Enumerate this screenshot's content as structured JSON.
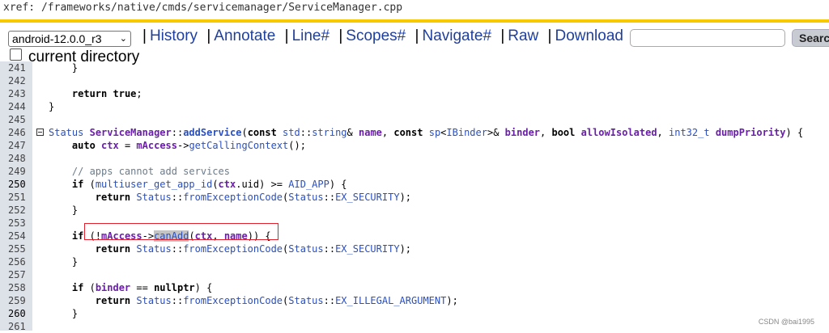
{
  "xref": {
    "path": "xref: /frameworks/native/cmds/servicemanager/ServiceManager.cpp"
  },
  "navbar": {
    "version": "android-12.0.0_r3",
    "links": [
      "History",
      "Annotate",
      "Line#",
      "Scopes#",
      "Navigate#",
      "Raw",
      "Download"
    ],
    "search_button": "Search",
    "search_value": ""
  },
  "current_directory": "current directory",
  "code": {
    "lines": [
      {
        "n": "241",
        "t": "    }"
      },
      {
        "n": "242",
        "t": ""
      },
      {
        "n": "243",
        "t": "    return true;"
      },
      {
        "n": "244",
        "t": "}"
      },
      {
        "n": "245",
        "t": ""
      },
      {
        "n": "246",
        "t": "Status ServiceManager::addService(const std::string& name, const sp<IBinder>& binder, bool allowIsolated, int32_t dumpPriority) {"
      },
      {
        "n": "247",
        "t": "    auto ctx = mAccess->getCallingContext();"
      },
      {
        "n": "248",
        "t": ""
      },
      {
        "n": "249",
        "t": "    // apps cannot add services"
      },
      {
        "n": "250",
        "t": "    if (multiuser_get_app_id(ctx.uid) >= AID_APP) {"
      },
      {
        "n": "251",
        "t": "        return Status::fromExceptionCode(Status::EX_SECURITY);"
      },
      {
        "n": "252",
        "t": "    }"
      },
      {
        "n": "253",
        "t": ""
      },
      {
        "n": "254",
        "t": "    if (!mAccess->canAdd(ctx, name)) {"
      },
      {
        "n": "255",
        "t": "        return Status::fromExceptionCode(Status::EX_SECURITY);"
      },
      {
        "n": "256",
        "t": "    }"
      },
      {
        "n": "257",
        "t": ""
      },
      {
        "n": "258",
        "t": "    if (binder == nullptr) {"
      },
      {
        "n": "259",
        "t": "        return Status::fromExceptionCode(Status::EX_ILLEGAL_ARGUMENT);"
      },
      {
        "n": "260",
        "t": "    }"
      },
      {
        "n": "261",
        "t": ""
      }
    ]
  },
  "watermark": "CSDN @bai1995",
  "colors": {
    "accent_yellow": "#f8c800",
    "link_blue": "#1f3f9f",
    "highlight_red": "#e0202a"
  }
}
